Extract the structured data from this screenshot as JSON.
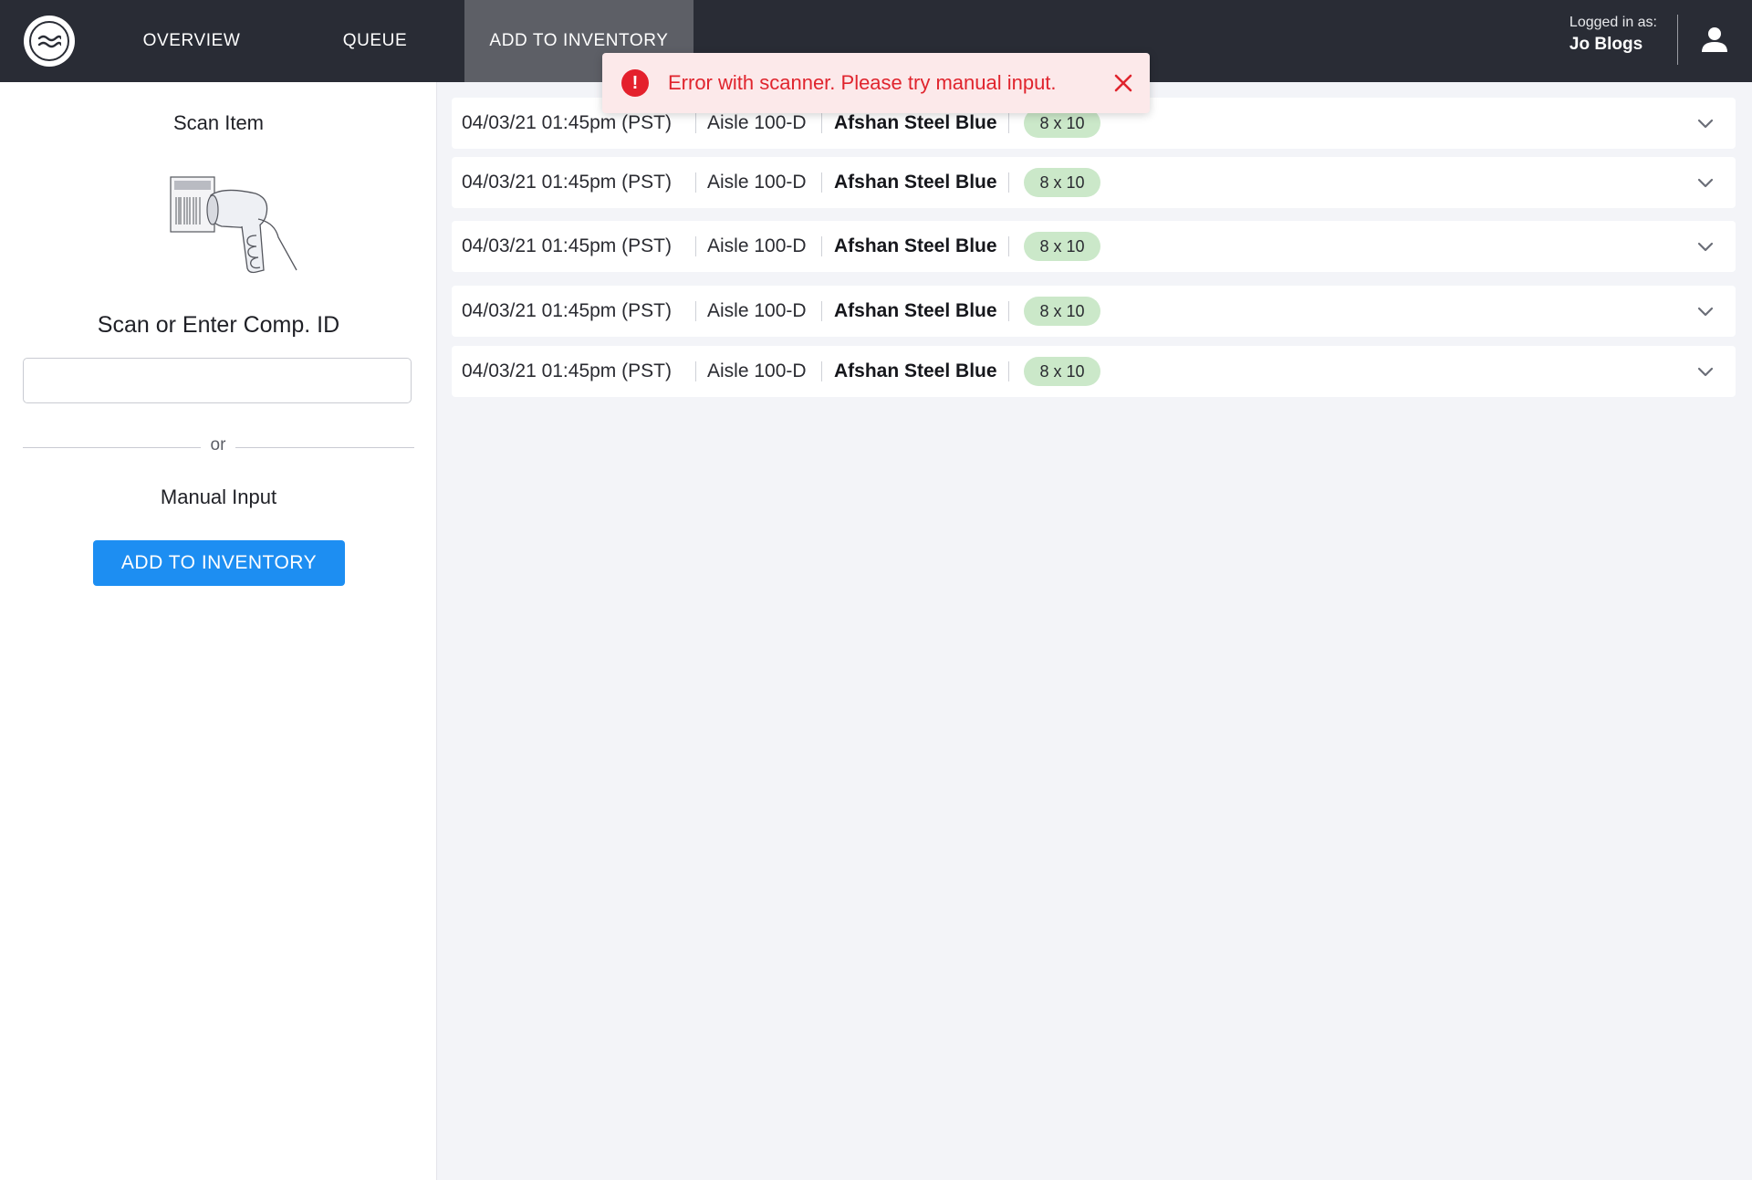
{
  "nav": {
    "tabs": [
      {
        "label": "OVERVIEW"
      },
      {
        "label": "QUEUE"
      },
      {
        "label": "ADD TO INVENTORY",
        "active": true
      }
    ],
    "logged_in_label": "Logged in as:",
    "user_name": "Jo Blogs",
    "logo_icon": "waves-logo-icon",
    "user_icon": "user-icon"
  },
  "left_panel": {
    "scan_title": "Scan Item",
    "scanner_icon": "barcode-scanner-illustration",
    "scan_enter_title": "Scan or Enter Comp. ID",
    "comp_id_value": "",
    "or_text": "or",
    "manual_title": "Manual Input",
    "add_button": "ADD TO INVENTORY"
  },
  "items": [
    {
      "timestamp": "04/03/21 01:45pm (PST)",
      "aisle": "Aisle 100-D",
      "name": "Afshan Steel Blue",
      "size": "8 x 10"
    },
    {
      "timestamp": "04/03/21 01:45pm (PST)",
      "aisle": "Aisle 100-D",
      "name": "Afshan Steel Blue",
      "size": "8 x 10"
    },
    {
      "timestamp": "04/03/21 01:45pm (PST)",
      "aisle": "Aisle 100-D",
      "name": "Afshan Steel Blue",
      "size": "8 x 10"
    },
    {
      "timestamp": "04/03/21 01:45pm (PST)",
      "aisle": "Aisle 100-D",
      "name": "Afshan Steel Blue",
      "size": "8 x 10"
    },
    {
      "timestamp": "04/03/21 01:45pm (PST)",
      "aisle": "Aisle 100-D",
      "name": "Afshan Steel Blue",
      "size": "8 x 10"
    }
  ],
  "toast": {
    "message": "Error with scanner. Please try manual input.",
    "icon": "error-icon",
    "close_icon": "close-icon"
  },
  "colors": {
    "nav_bg": "#292c35",
    "nav_active": "#5d5f66",
    "primary_button": "#1d8ef2",
    "badge_bg": "#cbe8c9",
    "error": "#e0242d",
    "toast_bg": "#fce9ea"
  }
}
